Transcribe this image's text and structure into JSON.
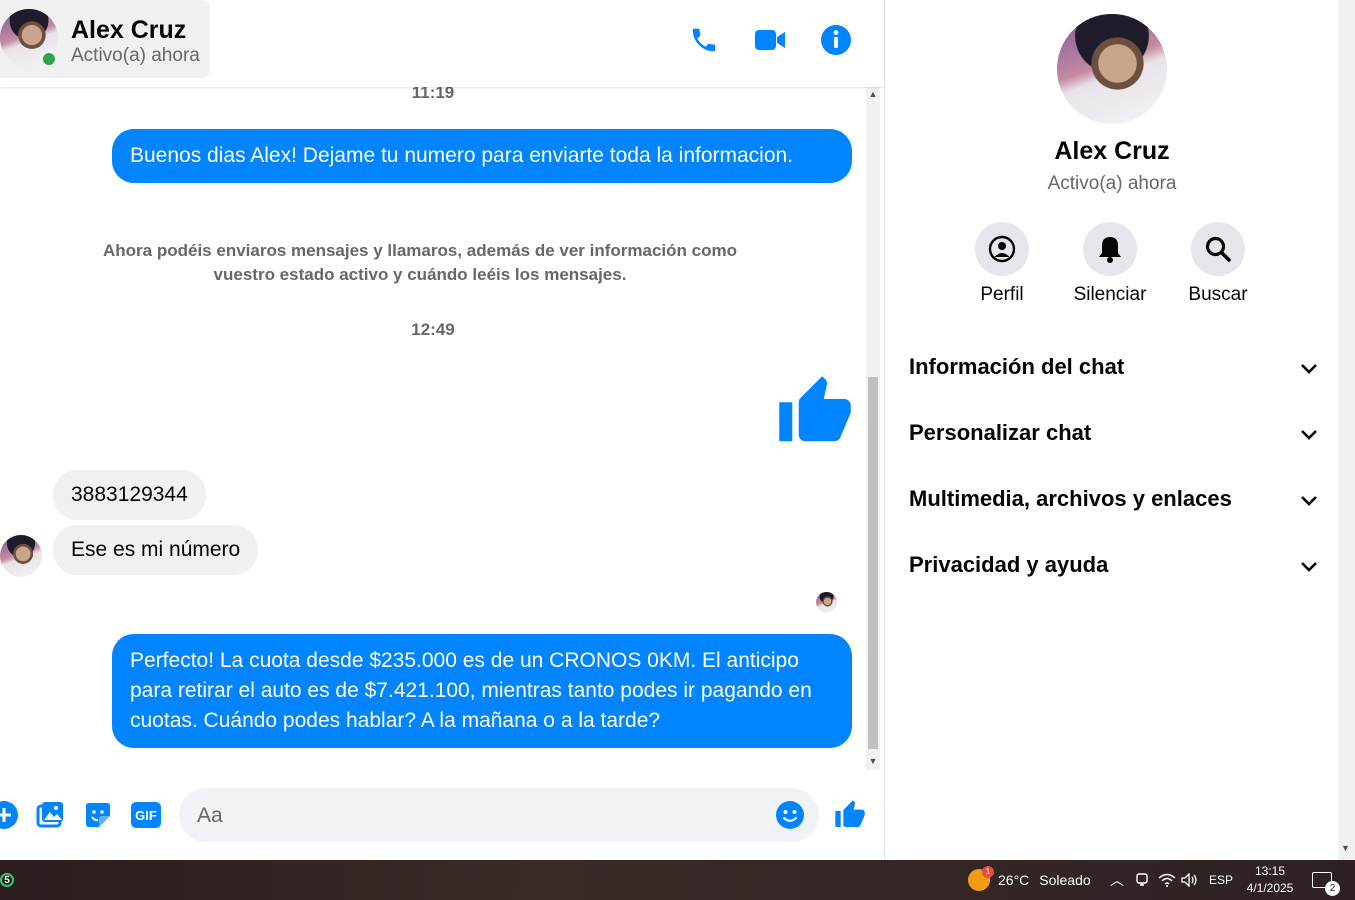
{
  "header": {
    "name": "Alex Cruz",
    "status": "Activo(a) ahora",
    "icons": [
      "phone-icon",
      "video-icon",
      "info-icon"
    ]
  },
  "messages": {
    "time_1": "11:19",
    "out_1": "Buenos dias Alex! Dejame tu numero para enviarte toda la informacion.",
    "system_note": "Ahora podéis enviaros mensajes y llamaros, además de ver información como vuestro estado activo y cuándo leéis los mensajes.",
    "time_2": "12:49",
    "in_1": "3883129344",
    "in_2": "Ese es mi número",
    "out_2": "Perfecto! La cuota desde $235.000 es de un CRONOS 0KM. El anticipo para retirar el auto es de $7.421.100, mientras tanto podes ir pagando en cuotas. Cuándo podes hablar? A la mañana o a la tarde?"
  },
  "composer": {
    "placeholder": "Aa",
    "gif_label": "GIF"
  },
  "panel": {
    "name": "Alex Cruz",
    "status": "Activo(a) ahora",
    "buttons": [
      {
        "label": "Perfil",
        "icon": "profile-icon"
      },
      {
        "label": "Silenciar",
        "icon": "bell-icon"
      },
      {
        "label": "Buscar",
        "icon": "search-icon"
      }
    ],
    "sections": [
      {
        "title": "Información del chat"
      },
      {
        "title": "Personalizar chat"
      },
      {
        "title": "Multimedia, archivos y enlaces"
      },
      {
        "title": "Privacidad y ayuda"
      }
    ]
  },
  "taskbar": {
    "badge_left": "5",
    "weather_temp": "26°C",
    "weather_text": "Soleado",
    "weather_alert": "1",
    "language": "ESP",
    "time": "13:15",
    "date": "4/1/2025",
    "notifications": "2"
  },
  "colors": {
    "accent": "#0084ff",
    "bubble_in": "#f0f0f0",
    "online": "#31a24c"
  }
}
